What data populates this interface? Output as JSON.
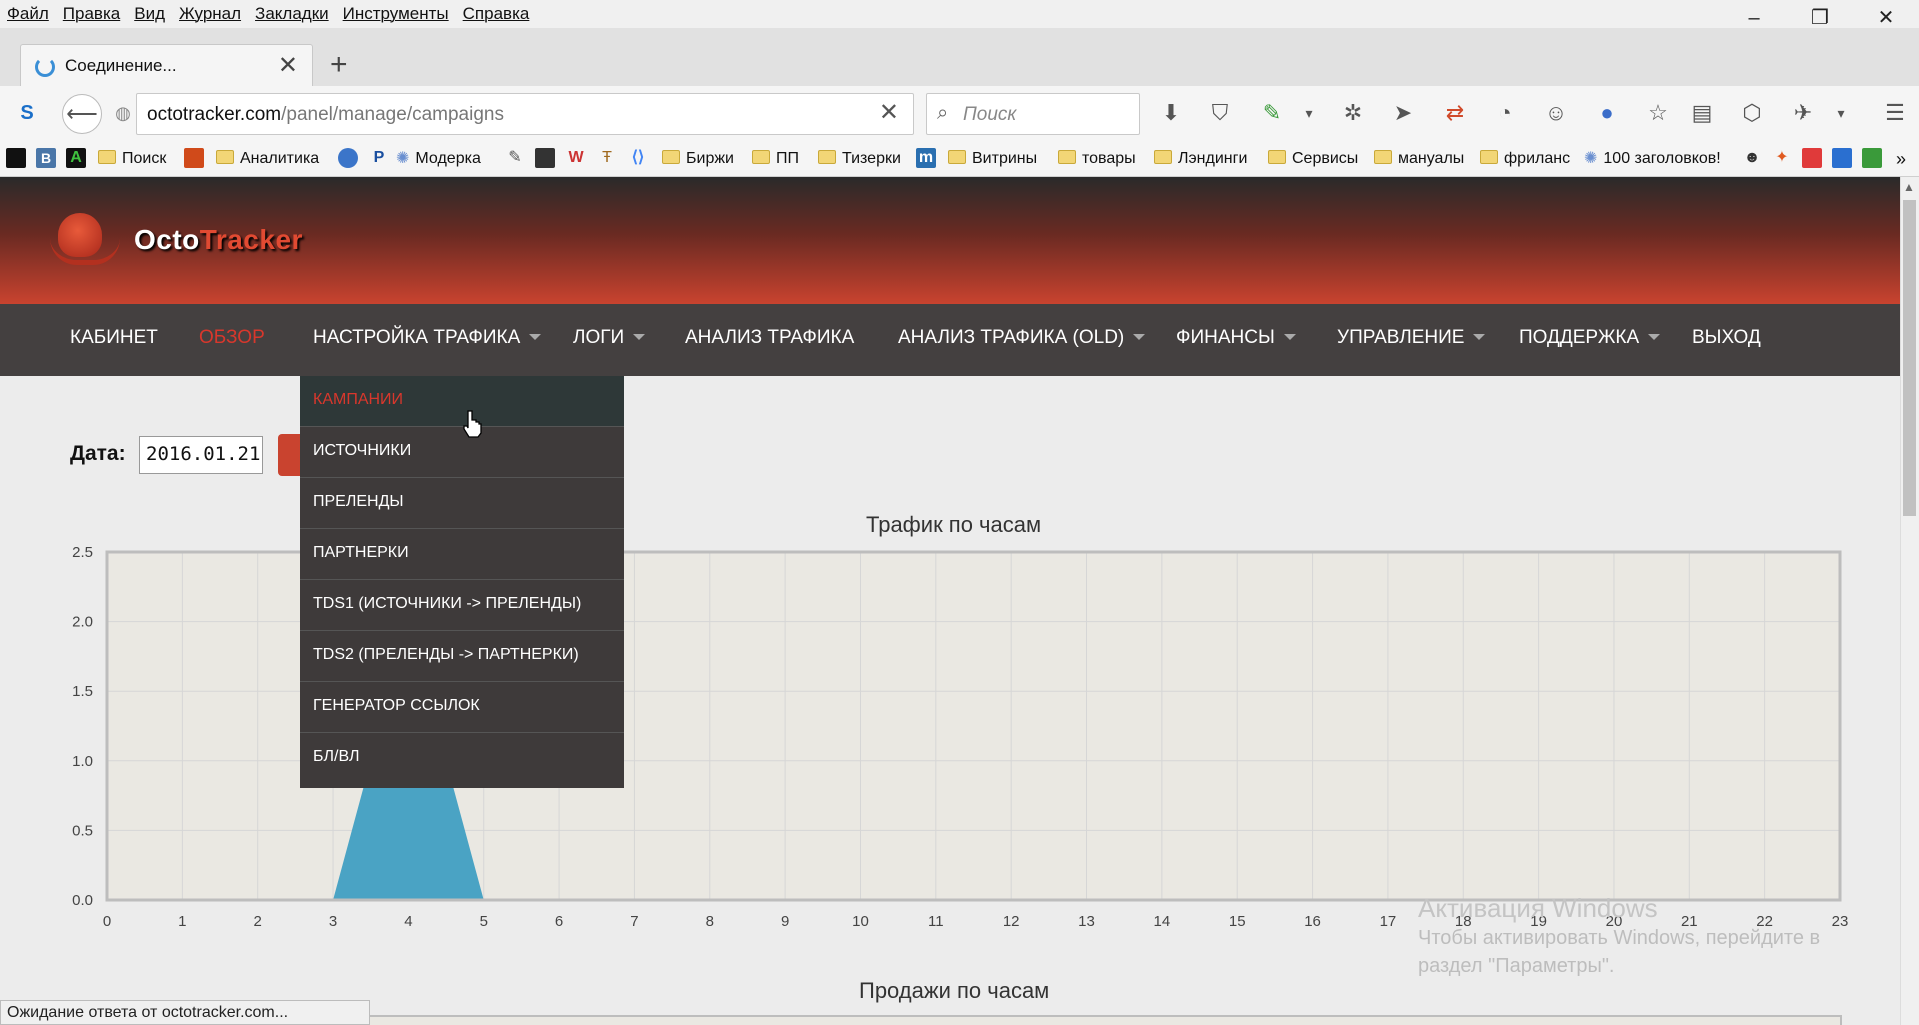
{
  "menubar": {
    "items": [
      "Файл",
      "Правка",
      "Вид",
      "Журнал",
      "Закладки",
      "Инструменты",
      "Справка"
    ]
  },
  "window": {
    "minimize": "–",
    "restore": "❐",
    "close": "✕"
  },
  "tab": {
    "title": "Соединение...",
    "close": "✕",
    "new_tab": "+"
  },
  "navbar": {
    "url_host": "octotracker.com",
    "url_path": "/panel/manage/campaigns",
    "url_clear": "✕",
    "search_placeholder": "Поиск"
  },
  "bookmarks": {
    "items": [
      "Поиск",
      "Аналитика",
      "Модерка",
      "Биржи",
      "ПП",
      "Тизерки",
      "Витрины",
      "товары",
      "Лэндинги",
      "Сервисы",
      "мануалы",
      "фриланс",
      "100 заголовков!"
    ],
    "overflow": "»"
  },
  "site": {
    "logo_part1": "Octo",
    "logo_part2": "Tracker",
    "nav": [
      "КАБИНЕТ",
      "ОБЗОР",
      "НАСТРОЙКА ТРАФИКА",
      "ЛОГИ",
      "АНАЛИЗ ТРАФИКА",
      "АНАЛИЗ ТРАФИКА (OLD)",
      "ФИНАНСЫ",
      "УПРАВЛЕНИЕ",
      "ПОДДЕРЖКА",
      "ВЫХОД"
    ],
    "date_label": "Дата:",
    "date_value": "2016.01.21"
  },
  "dropdown": {
    "items": [
      "КАМПАНИИ",
      "ИСТОЧНИКИ",
      "ПРЕЛЕНДЫ",
      "ПАРТНЕРКИ",
      "TDS1 (ИСТОЧНИКИ -> ПРЕЛЕНДЫ)",
      "TDS2 (ПРЕЛЕНДЫ -> ПАРТНЕРКИ)",
      "ГЕНЕРАТОР ССЫЛОК",
      "БЛ/ВЛ"
    ]
  },
  "colors": {
    "accent": "#d8372c",
    "nav_bg": "#444040",
    "area": "#4aa3c4"
  },
  "chart_data": [
    {
      "type": "area",
      "title": "Трафик по часам",
      "x": [
        0,
        1,
        2,
        3,
        4,
        5,
        6,
        7,
        8,
        9,
        10,
        11,
        12,
        13,
        14,
        15,
        16,
        17,
        18,
        19,
        20,
        21,
        22,
        23
      ],
      "values": [
        0,
        0,
        0,
        0,
        2,
        0,
        0,
        0,
        0,
        0,
        0,
        0,
        0,
        0,
        0,
        0,
        0,
        0,
        0,
        0,
        0,
        0,
        0,
        0
      ],
      "ylim": [
        0,
        2.5
      ],
      "yticks": [
        "0.0",
        "0.5",
        "1.0",
        "1.5",
        "2.0",
        "2.5"
      ],
      "grid": true
    },
    {
      "type": "area",
      "title": "Продажи по часам"
    }
  ],
  "statusbar": {
    "text": "Ожидание ответа от octotracker.com..."
  },
  "watermark": {
    "line1": "Активация Windows",
    "line2": "Чтобы активировать Windows, перейдите в",
    "line3": "раздел \"Параметры\"."
  }
}
